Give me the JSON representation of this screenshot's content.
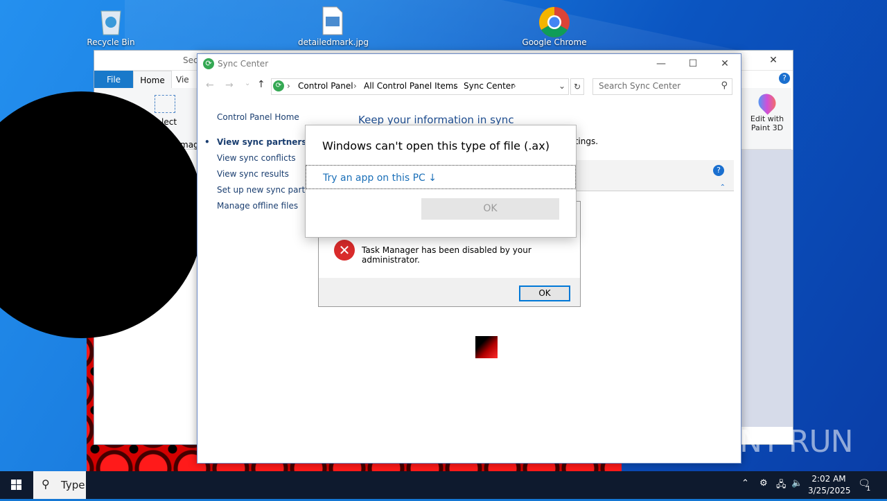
{
  "desktop": {
    "icons": [
      {
        "label": "Recycle Bin",
        "icon": "recycle-bin-icon"
      },
      {
        "label": "detailedmark.jpg",
        "icon": "image-file-icon"
      },
      {
        "label": "Google Chrome",
        "icon": "chrome-icon"
      }
    ],
    "watermark": "ANY RUN"
  },
  "explorer": {
    "qat_partial": "Sec",
    "tabs": {
      "file": "File",
      "home": "Home",
      "view": "Vie"
    },
    "ribbon_partial": {
      "select": "lect",
      "image": "mage"
    },
    "paint3d": "Edit with Paint 3D"
  },
  "sync_center": {
    "title": "Sync Center",
    "breadcrumb": [
      "Control Panel",
      "All Control Panel Items",
      "Sync Center"
    ],
    "search_placeholder": "Search Sync Center",
    "nav": [
      "Control Panel Home",
      "View sync partnerships",
      "View sync conflicts",
      "View sync results",
      "Set up new sync partner",
      "Manage offline files"
    ],
    "heading": "Keep your information in sync",
    "subtext_partial": "ttings."
  },
  "open_with_dialog": {
    "title": "Windows can't open this type of file (.ax)",
    "try_app": "Try an app on this PC ↓",
    "ok": "OK"
  },
  "task_manager_dialog": {
    "message": "Task Manager has been disabled by your administrator.",
    "ok": "OK"
  },
  "taskbar": {
    "search_text": "Type",
    "time": "2:02 AM",
    "date": "3/25/2025",
    "notification_count": "1"
  }
}
